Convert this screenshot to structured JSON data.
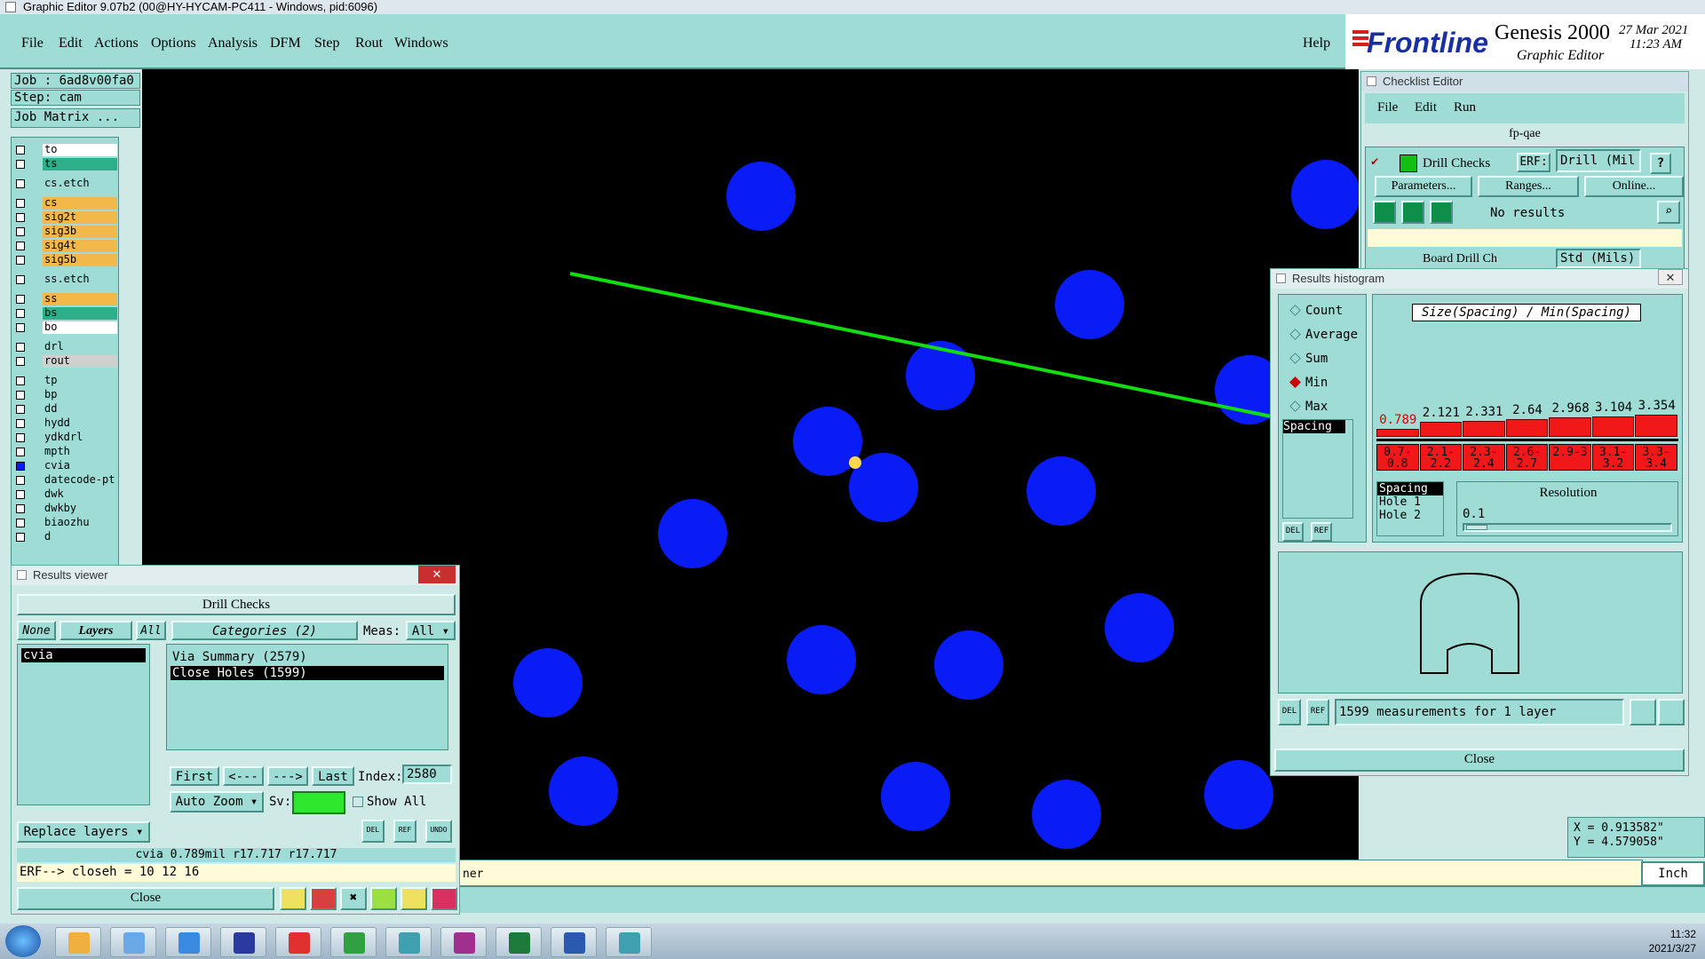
{
  "window": {
    "title": "Graphic Editor 9.07b2 (00@HY-HYCAM-PC411 - Windows, pid:6096)"
  },
  "menu": {
    "items": [
      "File",
      "Edit",
      "Actions",
      "Options",
      "Analysis",
      "DFM",
      "Step",
      "Rout",
      "Windows"
    ],
    "help": "Help"
  },
  "brand": {
    "logo": "Frontline",
    "product": "Genesis 2000",
    "subtitle": "Graphic Editor",
    "date": "27 Mar 2021",
    "time": "11:23 AM"
  },
  "job": {
    "job_label": "Job : 6ad8v00fa0",
    "step_label": "Step: cam",
    "matrix_button": "Job Matrix ..."
  },
  "layers": [
    {
      "name": "to",
      "color": "#ffffff",
      "on": false
    },
    {
      "name": "ts",
      "color": "#2fae8a",
      "on": false
    },
    {
      "name": "cs.etch",
      "color": "#9fdcd6",
      "on": false
    },
    {
      "name": "cs",
      "color": "#f2b84a",
      "on": false
    },
    {
      "name": "sig2t",
      "color": "#f2b84a",
      "on": false
    },
    {
      "name": "sig3b",
      "color": "#f2b84a",
      "on": false
    },
    {
      "name": "sig4t",
      "color": "#f2b84a",
      "on": false
    },
    {
      "name": "sig5b",
      "color": "#f2b84a",
      "on": false
    },
    {
      "name": "ss.etch",
      "color": "#9fdcd6",
      "on": false
    },
    {
      "name": "ss",
      "color": "#f2b84a",
      "on": false
    },
    {
      "name": "bs",
      "color": "#2fae8a",
      "on": false
    },
    {
      "name": "bo",
      "color": "#ffffff",
      "on": false
    },
    {
      "name": "drl",
      "color": "#9fdcd6",
      "on": false
    },
    {
      "name": "rout",
      "color": "#d0d0d0",
      "on": false
    },
    {
      "name": "tp",
      "color": "#9fdcd6",
      "on": false
    },
    {
      "name": "bp",
      "color": "#9fdcd6",
      "on": false
    },
    {
      "name": "dd",
      "color": "#9fdcd6",
      "on": false
    },
    {
      "name": "hydd",
      "color": "#9fdcd6",
      "on": false
    },
    {
      "name": "ydkdrl",
      "color": "#9fdcd6",
      "on": false
    },
    {
      "name": "mpth",
      "color": "#9fdcd6",
      "on": false
    },
    {
      "name": "cvia",
      "color": "#9fdcd6",
      "on": true
    },
    {
      "name": "datecode-pt",
      "color": "#9fdcd6",
      "on": false
    },
    {
      "name": "dwk",
      "color": "#9fdcd6",
      "on": false
    },
    {
      "name": "dwkby",
      "color": "#9fdcd6",
      "on": false
    },
    {
      "name": "biaozhu",
      "color": "#9fdcd6",
      "on": false
    },
    {
      "name": "d",
      "color": "#9fdcd6",
      "on": false
    }
  ],
  "results_viewer": {
    "title": "Results viewer",
    "check_name": "Drill Checks",
    "none": "None",
    "layers": "Layers",
    "all": "All",
    "categories": "Categories (2)",
    "meas_label": "Meas:",
    "meas_value": "All",
    "layer_list": [
      "cvia"
    ],
    "category_list": [
      "Via Summary (2579)",
      "Close Holes (1599)"
    ],
    "nav": {
      "first": "First",
      "prev": "<---",
      "next": "--->",
      "last": "Last",
      "index_label": "Index:",
      "index_value": "2580"
    },
    "auto_zoom": "Auto Zoom",
    "sv_label": "Sv:",
    "show_all": "Show All",
    "replace_layers": "Replace layers",
    "del": "DEL",
    "ref": "REF",
    "undo": "UNDO",
    "status": "cvia 0.789mil   r17.717   r17.717",
    "erf_line": "ERF--> closeh = 10 12 16",
    "close": "Close"
  },
  "checklist_editor": {
    "title": "Checklist Editor",
    "menu": [
      "File",
      "Edit",
      "Run"
    ],
    "checklist_name": "fp-qae",
    "check_name": "Drill Checks",
    "erf_label": "ERF:",
    "erf_value": "Drill (Mil",
    "help": "?",
    "buttons": [
      "Parameters...",
      "Ranges...",
      "Online..."
    ],
    "results": "No results",
    "second_check": "Board Drill Ch",
    "second_erf": "Std (Mils)"
  },
  "histogram": {
    "title": "Results histogram",
    "heading": "Size(Spacing) / Min(Spacing)",
    "modes": [
      {
        "label": "Count",
        "selected": false
      },
      {
        "label": "Average",
        "selected": false
      },
      {
        "label": "Sum",
        "selected": false
      },
      {
        "label": "Min",
        "selected": true
      },
      {
        "label": "Max",
        "selected": false
      }
    ],
    "list_item": "Spacing",
    "bins": [
      {
        "value": "0.789",
        "range": "0.7-0.8",
        "level": 0.2
      },
      {
        "value": "2.121",
        "range": "2.1-2.2",
        "level": 0.55
      },
      {
        "value": "2.331",
        "range": "2.3-2.4",
        "level": 0.6
      },
      {
        "value": "2.64",
        "range": "2.6-2.7",
        "level": 0.68
      },
      {
        "value": "2.968",
        "range": "2.9-3",
        "level": 0.76
      },
      {
        "value": "3.104",
        "range": "3.1-3.2",
        "level": 0.8
      },
      {
        "value": "3.354",
        "range": "3.3-3.4",
        "level": 0.86
      }
    ],
    "measure_list": [
      "Spacing",
      "Hole 1",
      "Hole 2"
    ],
    "resolution_label": "Resolution",
    "resolution_value": "0.1",
    "measurements": "1599 measurements for 1 layer",
    "del": "DEL",
    "ref": "REF",
    "close": "Close"
  },
  "status_bar": {
    "message": "ner",
    "x": "X = 0.913582\"",
    "y": "Y = 4.579058\"",
    "unit": "Inch"
  },
  "taskbar": {
    "time": "11:32",
    "date": "2021/3/27"
  }
}
